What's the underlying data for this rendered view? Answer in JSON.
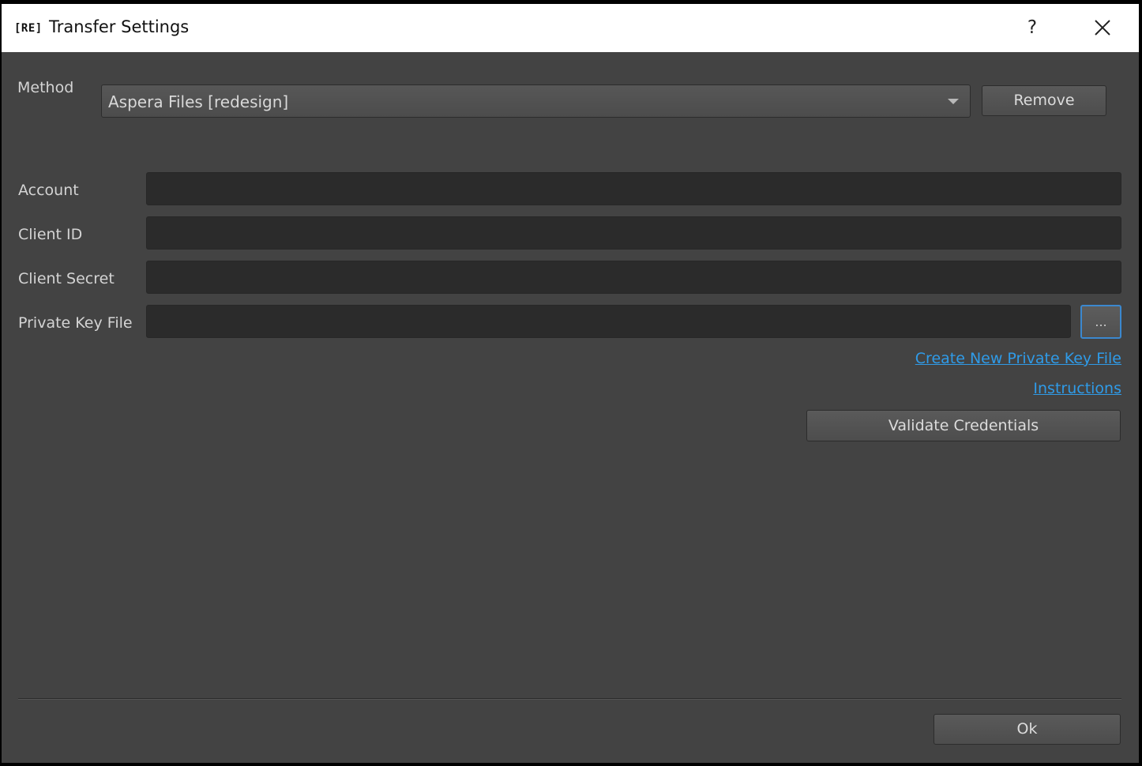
{
  "window": {
    "app_logo": "[RE]",
    "title": "Transfer Settings",
    "help_symbol": "?"
  },
  "method": {
    "label": "Method",
    "selected": "Aspera Files [redesign]",
    "remove_label": "Remove"
  },
  "fields": {
    "account_label": "Account",
    "account_value": "",
    "client_id_label": "Client ID",
    "client_id_value": "",
    "client_secret_label": "Client Secret",
    "client_secret_value": "",
    "private_key_label": "Private Key File",
    "private_key_value": "",
    "browse_label": "..."
  },
  "links": {
    "create_key": "Create New Private Key File",
    "instructions": "Instructions"
  },
  "validate_label": "Validate Credentials",
  "ok_label": "Ok",
  "colors": {
    "background": "#434343",
    "field": "#2b2b2b",
    "link": "#2f9be8",
    "focus": "#3b88cf"
  }
}
